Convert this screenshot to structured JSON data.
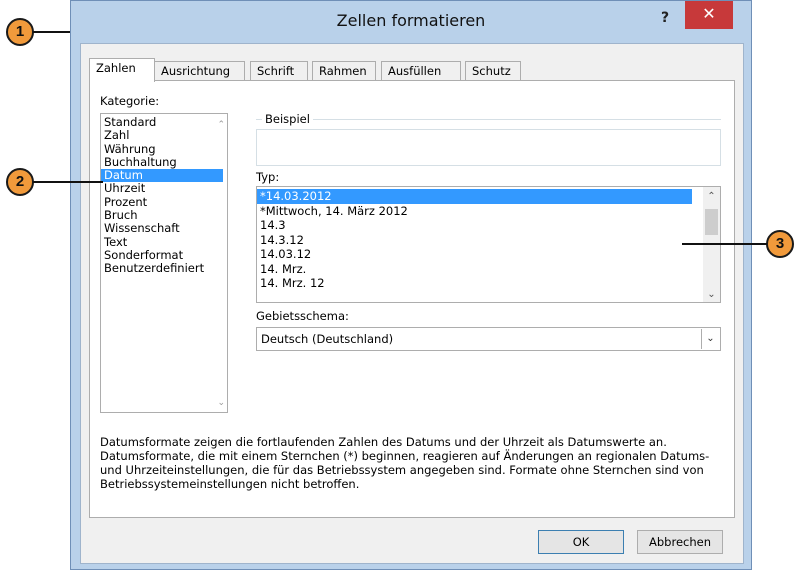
{
  "window": {
    "title": "Zellen formatieren",
    "help": "?",
    "close": "✕"
  },
  "tabs": [
    "Zahlen",
    "Ausrichtung",
    "Schrift",
    "Rahmen",
    "Ausfüllen",
    "Schutz"
  ],
  "category": {
    "label": "Kategorie:",
    "items": [
      "Standard",
      "Zahl",
      "Währung",
      "Buchhaltung",
      "Datum",
      "Uhrzeit",
      "Prozent",
      "Bruch",
      "Wissenschaft",
      "Text",
      "Sonderformat",
      "Benutzerdefiniert"
    ],
    "selected": "Datum"
  },
  "sample": {
    "label": "Beispiel"
  },
  "type": {
    "label": "Typ:",
    "items": [
      "*14.03.2012",
      "*Mittwoch, 14. März 2012",
      "14.3",
      "14.3.12",
      "14.03.12",
      "14. Mrz.",
      "14. Mrz. 12"
    ],
    "selected": "*14.03.2012"
  },
  "locale": {
    "label": "Gebietsschema:",
    "value": "Deutsch (Deutschland)"
  },
  "description": "Datumsformate zeigen die fortlaufenden Zahlen des Datums und der Uhrzeit als Datumswerte an. Datumsformate, die mit einem Sternchen (*) beginnen, reagieren auf Änderungen an regionalen Datums- und Uhrzeiteinstellungen, die für das Betriebssystem angegeben sind. Formate ohne Sternchen sind von Betriebssystemeinstellungen nicht betroffen.",
  "buttons": {
    "ok": "OK",
    "cancel": "Abbrechen"
  },
  "callouts": [
    "1",
    "2",
    "3"
  ],
  "colors": {
    "selection": "#3399ff",
    "close": "#c7393a",
    "callout": "#f19a3b",
    "frame": "#b9d1ea"
  }
}
